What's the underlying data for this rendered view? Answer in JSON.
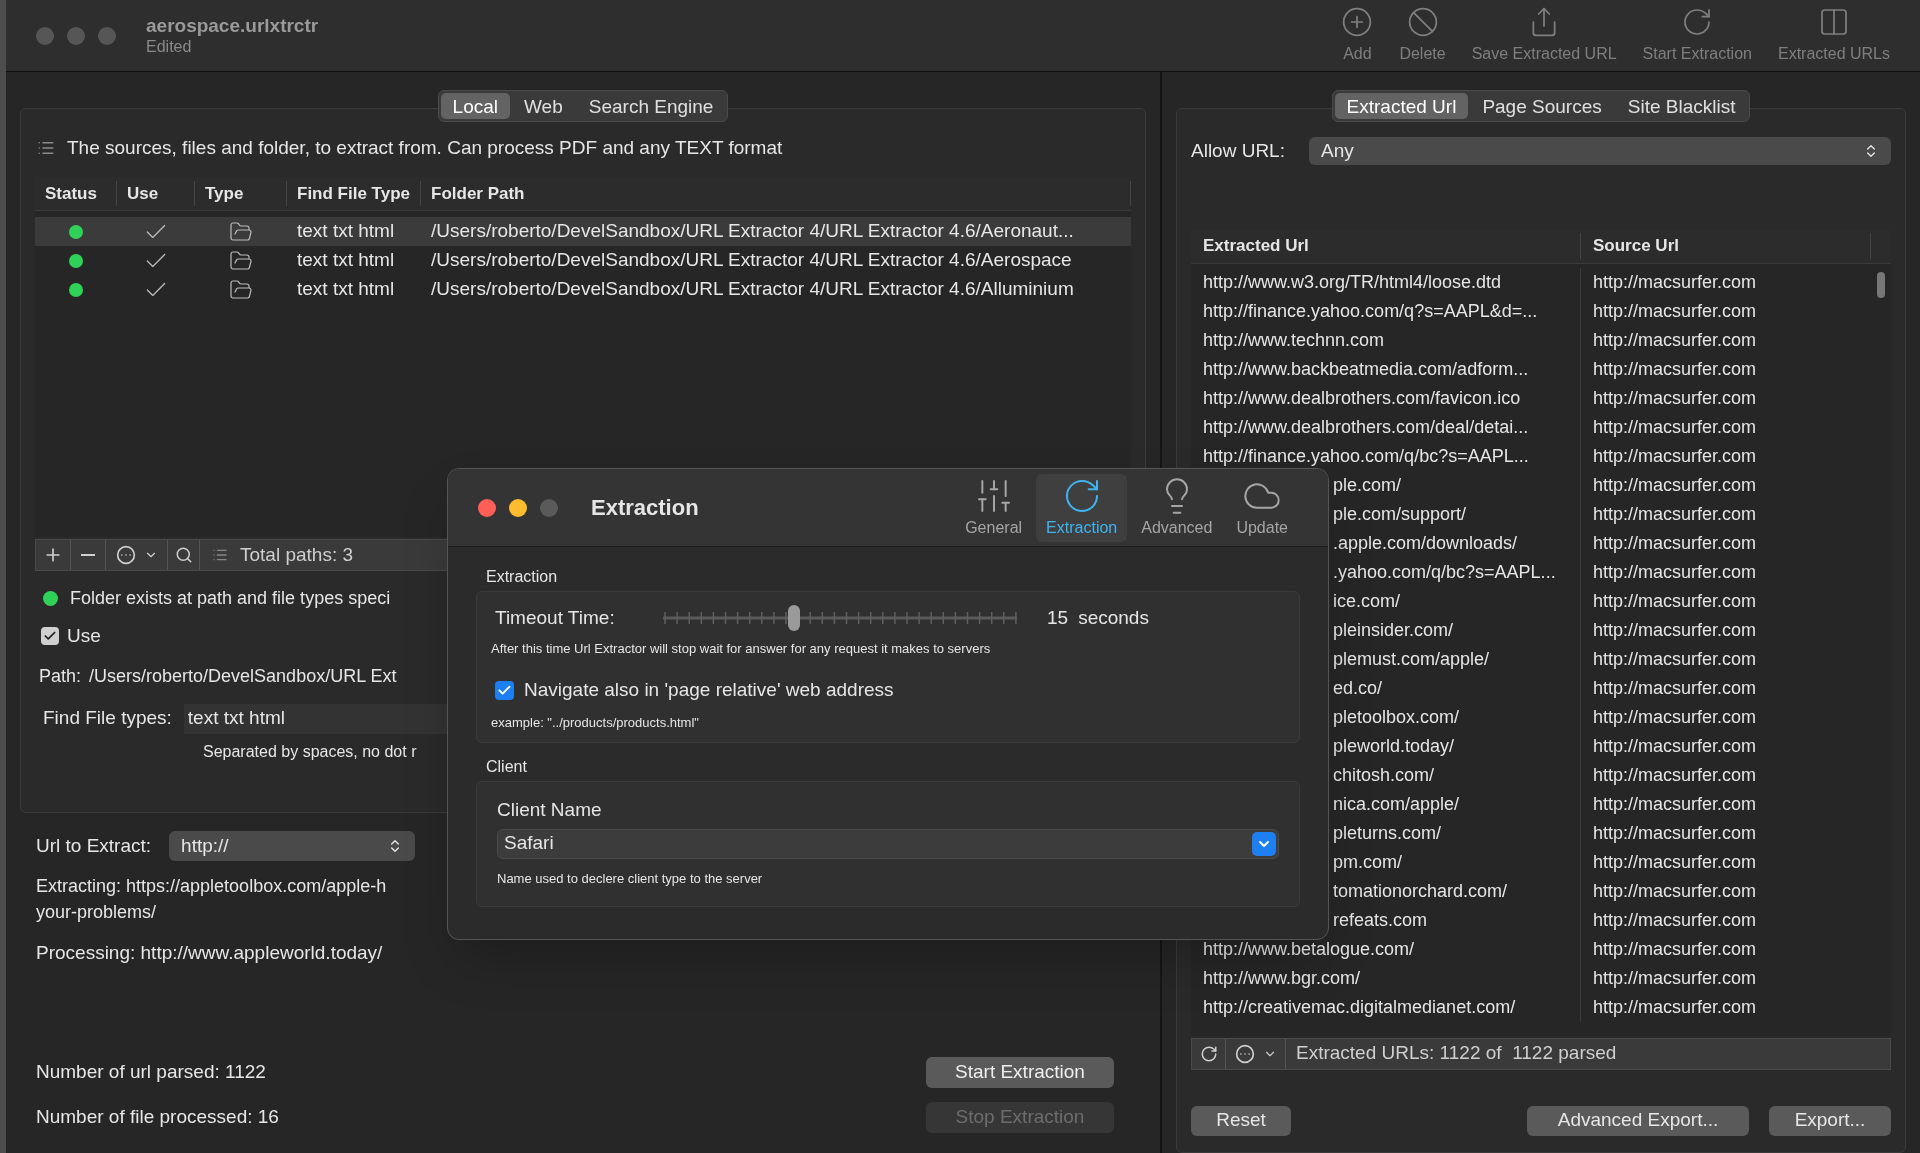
{
  "window": {
    "title": "aerospace.urlxtrctr",
    "subtitle": "Edited"
  },
  "toolbar": [
    {
      "kind": "add",
      "label": "Add"
    },
    {
      "kind": "delete",
      "label": "Delete"
    },
    {
      "kind": "share",
      "label": "Save Extracted URL"
    },
    {
      "kind": "refresh",
      "label": "Start Extraction"
    },
    {
      "kind": "columns",
      "label": "Extracted URLs"
    }
  ],
  "left": {
    "tabs": [
      {
        "label": "Local",
        "selected": true
      },
      {
        "label": "Web",
        "selected": false
      },
      {
        "label": "Search Engine",
        "selected": false
      }
    ],
    "description": "The sources, files and folder, to extract from. Can process PDF and any TEXT format",
    "table": {
      "columns": [
        "Status",
        "Use",
        "Type",
        "Find File Type",
        "Folder Path"
      ],
      "rows": [
        {
          "status": {
            "color": "#30d158"
          },
          "use": true,
          "find_file_type": "text txt html",
          "folder_path": "/Users/roberto/DevelSandbox/URL Extractor 4/URL Extractor 4.6/Aeronaut...",
          "selected": true
        },
        {
          "status": {
            "color": "#30d158"
          },
          "use": true,
          "find_file_type": "text txt html",
          "folder_path": "/Users/roberto/DevelSandbox/URL Extractor 4/URL Extractor 4.6/Aerospace",
          "selected": false
        },
        {
          "status": {
            "color": "#30d158"
          },
          "use": true,
          "find_file_type": "text txt html",
          "folder_path": "/Users/roberto/DevelSandbox/URL Extractor 4/URL Extractor 4.6/Alluminium",
          "selected": false
        }
      ]
    },
    "total_paths": "Total paths: 3",
    "status": {
      "text": "Folder exists at path and file types speci",
      "color": "#30d158"
    },
    "use": {
      "label": "Use",
      "checked": true
    },
    "path": {
      "label": "Path:",
      "value": "/Users/roberto/DevelSandbox/URL Ext"
    },
    "file_types": {
      "label": "Find File types:",
      "value": "text txt html",
      "hint": "Separated by spaces, no dot r"
    },
    "url_to_extract": {
      "label": "Url to Extract:",
      "value": "http://"
    },
    "extracting": [
      "Extracting: https://appletoolbox.com/apple-h",
      "your-problems/"
    ],
    "processing": "Processing: http://www.appleworld.today/",
    "url_parsed": "Number of url parsed: 1122",
    "file_processed": "Number of file processed: 16",
    "buttons": [
      {
        "label": "Start Extraction",
        "disabled": false
      },
      {
        "label": "Stop Extraction",
        "disabled": true
      }
    ]
  },
  "right": {
    "tabs": [
      {
        "label": "Extracted Url",
        "selected": true
      },
      {
        "label": "Page Sources",
        "selected": false
      },
      {
        "label": "Site Blacklist",
        "selected": false
      }
    ],
    "allow_url": {
      "label": "Allow URL:",
      "value": "Any"
    },
    "columns": [
      "Extracted Url",
      "Source Url"
    ],
    "rows": [
      {
        "extracted": "http://www.w3.org/TR/html4/loose.dtd",
        "source": "http://macsurfer.com"
      },
      {
        "extracted": "http://finance.yahoo.com/q?s=AAPL&d=...",
        "source": "http://macsurfer.com"
      },
      {
        "extracted": "http://www.technn.com",
        "source": "http://macsurfer.com"
      },
      {
        "extracted": "http://www.backbeatmedia.com/adform...",
        "source": "http://macsurfer.com"
      },
      {
        "extracted": "http://www.dealbrothers.com/favicon.ico",
        "source": "http://macsurfer.com"
      },
      {
        "extracted": "http://www.dealbrothers.com/deal/detai...",
        "source": "http://macsurfer.com"
      },
      {
        "extracted": "http://finance.yahoo.com/q/bc?s=AAPL...",
        "source": "http://macsurfer.com"
      }
    ],
    "rows_behind_dialog": [
      {
        "extracted": "ple.com/",
        "source": "http://macsurfer.com"
      },
      {
        "extracted": "ple.com/support/",
        "source": "http://macsurfer.com"
      },
      {
        "extracted": ".apple.com/downloads/",
        "source": "http://macsurfer.com"
      },
      {
        "extracted": ".yahoo.com/q/bc?s=AAPL...",
        "source": "http://macsurfer.com"
      },
      {
        "extracted": "ice.com/",
        "source": "http://macsurfer.com"
      },
      {
        "extracted": "pleinsider.com/",
        "source": "http://macsurfer.com"
      },
      {
        "extracted": "plemust.com/apple/",
        "source": "http://macsurfer.com"
      },
      {
        "extracted": "ed.co/",
        "source": "http://macsurfer.com"
      },
      {
        "extracted": "pletoolbox.com/",
        "source": "http://macsurfer.com"
      },
      {
        "extracted": "pleworld.today/",
        "source": "http://macsurfer.com"
      },
      {
        "extracted": "chitosh.com/",
        "source": "http://macsurfer.com"
      },
      {
        "extracted": "nica.com/apple/",
        "source": "http://macsurfer.com"
      },
      {
        "extracted": "pleturns.com/",
        "source": "http://macsurfer.com"
      },
      {
        "extracted": "pm.com/",
        "source": "http://macsurfer.com"
      },
      {
        "extracted": "tomationorchard.com/",
        "source": "http://macsurfer.com"
      },
      {
        "extracted": "refeats.com",
        "source": "http://macsurfer.com"
      }
    ],
    "rows_below_dialog": [
      {
        "extracted": "http://www.betalogue.com/",
        "source": "http://macsurfer.com"
      },
      {
        "extracted": "http://www.bgr.com/",
        "source": "http://macsurfer.com"
      },
      {
        "extracted": "http://creativemac.digitalmedianet.com/",
        "source": "http://macsurfer.com"
      }
    ],
    "summary": "Extracted URLs: 1122 of  1122 parsed",
    "buttons": [
      "Reset",
      "Advanced Export...",
      "Export..."
    ]
  },
  "dialog": {
    "title": "Extraction",
    "tabs": [
      {
        "kind": "general",
        "label": "General",
        "selected": false
      },
      {
        "kind": "extraction",
        "label": "Extraction",
        "selected": true
      },
      {
        "kind": "advanced",
        "label": "Advanced",
        "selected": false
      },
      {
        "kind": "update",
        "label": "Update",
        "selected": false
      }
    ],
    "extraction": {
      "title": "Extraction",
      "timeout_label": "Timeout Time:",
      "level": 0.37,
      "value": "15",
      "unit": "seconds",
      "hint": "After this time Url Extractor will stop wait for answer for any request it makes to servers",
      "checkbox": {
        "label": "Navigate also in 'page relative' web address",
        "checked": true
      },
      "example": "example: \"../products/products.html\""
    },
    "client": {
      "title": "Client",
      "label": "Client Name",
      "value": "Safari",
      "hint": "Name used to declere client type to the server"
    }
  }
}
